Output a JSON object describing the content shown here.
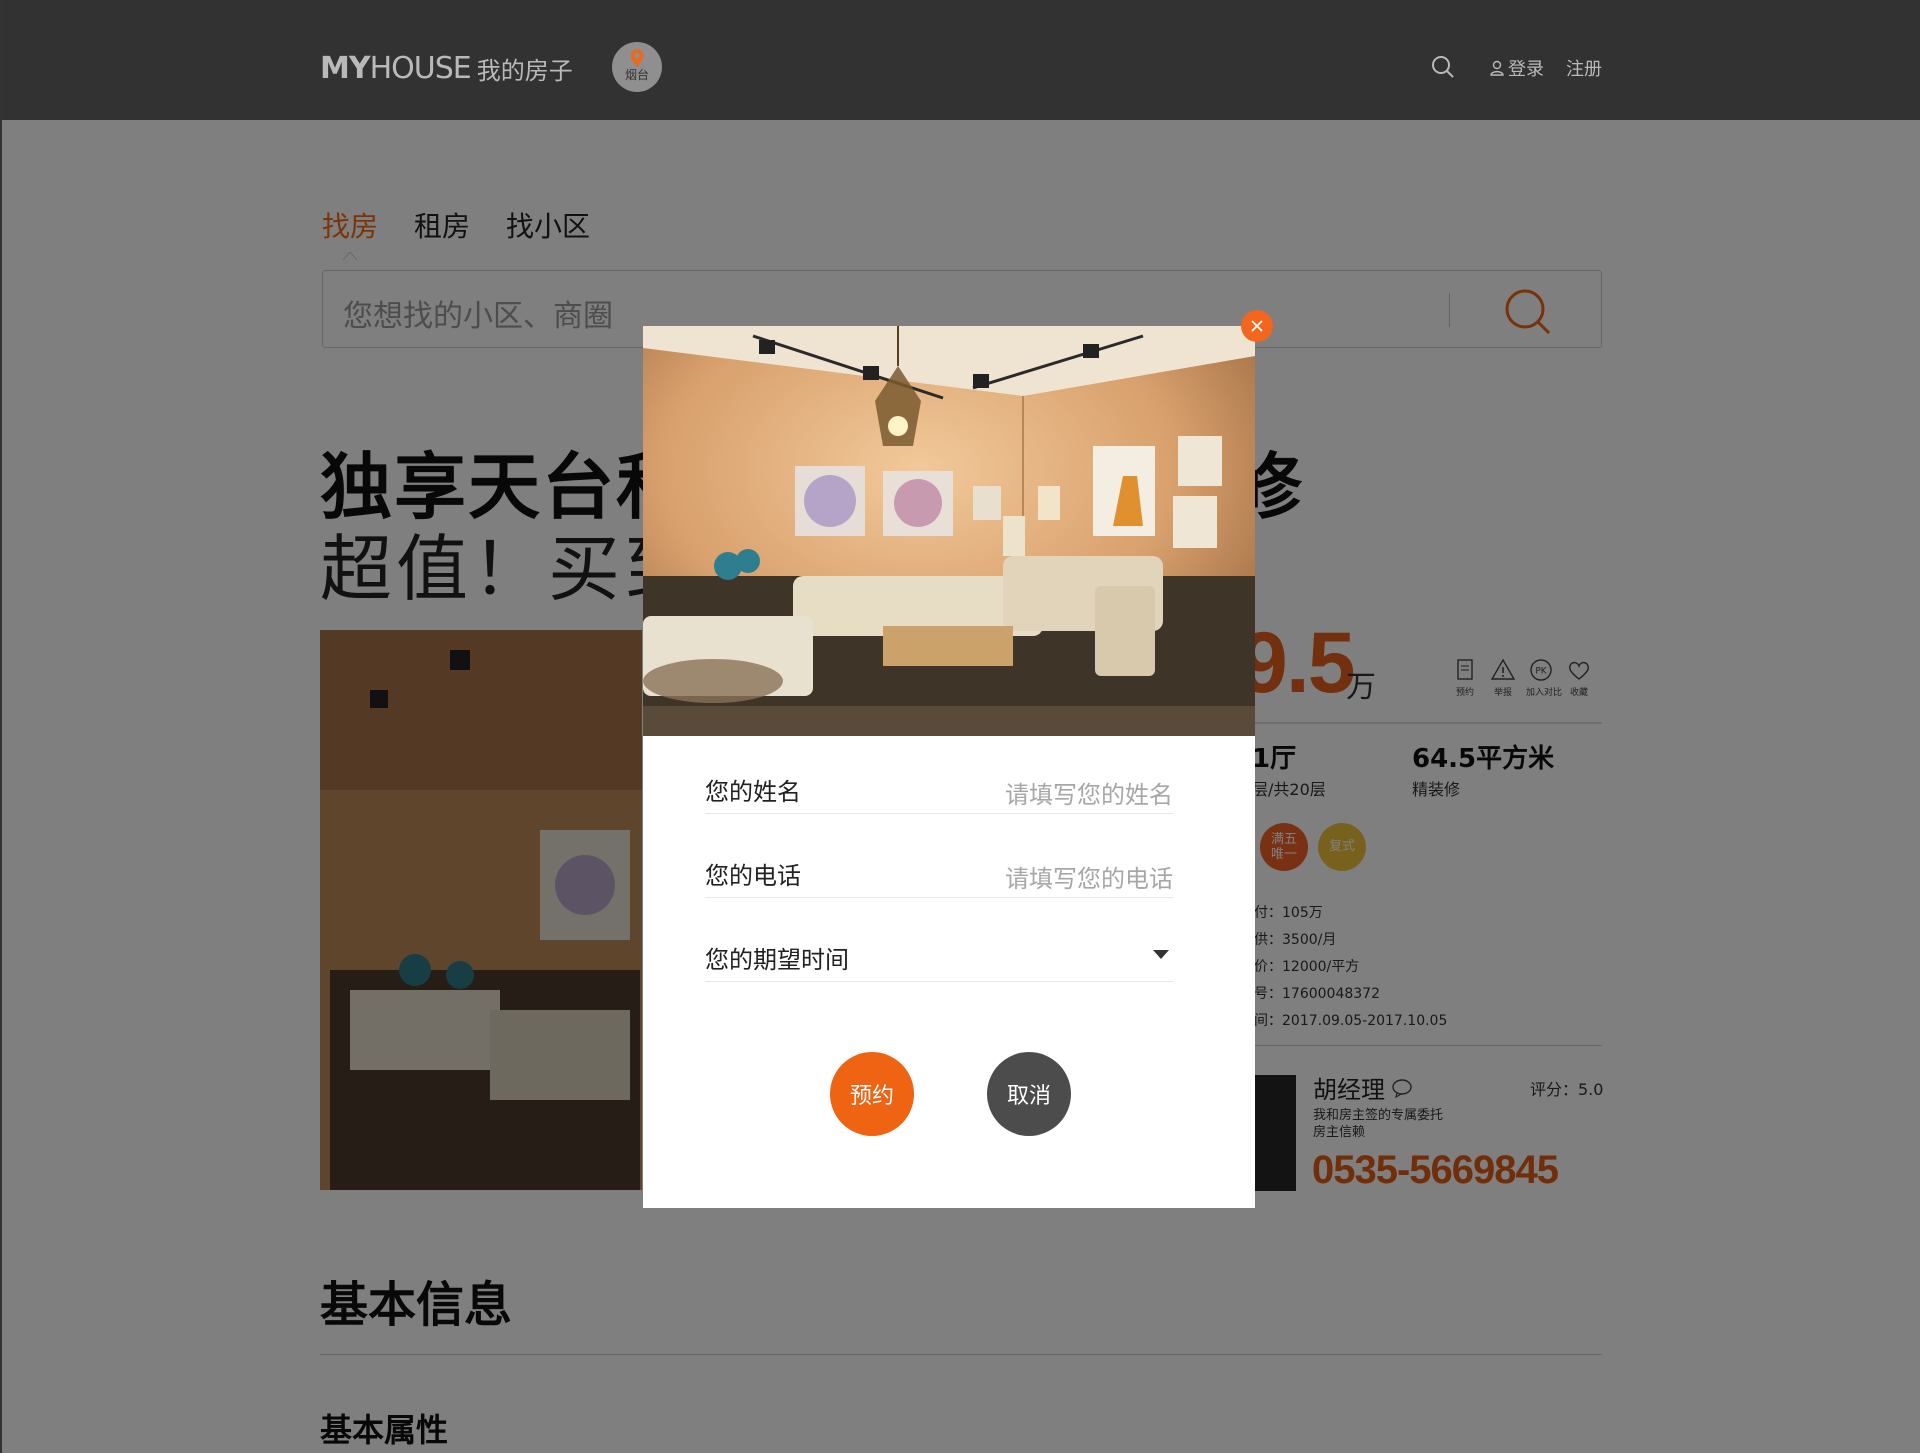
{
  "header": {
    "logo_my": "MY",
    "logo_house": "HOUSE",
    "logo_cn": "我的房子",
    "city": "烟台",
    "login": "登录",
    "register": "注册"
  },
  "search": {
    "tabs": [
      "找房",
      "租房",
      "找小区"
    ],
    "placeholder": "您想找的小区、商圈"
  },
  "listing": {
    "title_line1": "独享天台私",
    "title_line1_tail": "修",
    "title_line2": "超值！买到",
    "price_visible": "9.5",
    "price_unit": "万",
    "actions": [
      {
        "icon": "document-icon",
        "label": "预约"
      },
      {
        "icon": "warning-icon",
        "label": "举报"
      },
      {
        "icon": "pk-icon",
        "label": "加入对比"
      },
      {
        "icon": "heart-icon",
        "label": "收藏"
      }
    ],
    "layout_main": "1厅",
    "layout_sub": "层/共20层",
    "area_main": "64.5平方米",
    "area_sub": "精装修",
    "tags": [
      "满五\n唯一",
      "复式"
    ],
    "facts": [
      "付：105万",
      "供：3500/月",
      "价：12000/平方",
      "号：17600048372",
      "间：2017.09.05-2017.10.05"
    ]
  },
  "agent": {
    "name": "胡经理",
    "rating": "评分：5.0",
    "desc": "我和房主签的专属委托 房主信赖",
    "phone": "0535-5669845"
  },
  "sections": {
    "basic_info": "基本信息",
    "basic_attr": "基本属性"
  },
  "modal": {
    "name_label": "您的姓名",
    "name_placeholder": "请填写您的姓名",
    "phone_label": "您的电话",
    "phone_placeholder": "请填写您的电话",
    "time_label": "您的期望时间",
    "book_button": "预约",
    "cancel_button": "取消"
  },
  "colors": {
    "accent": "#ef6413",
    "header_bg": "#323232",
    "overlay": "rgba(0,0,0,0.5)",
    "cancel_bg": "#4c4c4c"
  }
}
